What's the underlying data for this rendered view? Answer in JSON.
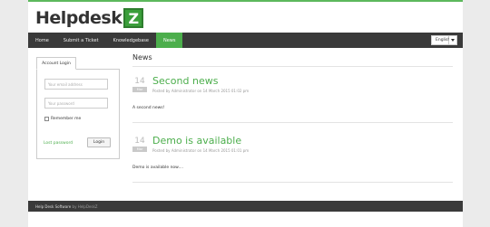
{
  "logo": {
    "text": "Helpdesk",
    "badge": "Z"
  },
  "nav": {
    "items": [
      "Home",
      "Submit a Ticket",
      "Knowledgebase",
      "News"
    ],
    "active": "News"
  },
  "language": {
    "selected": "English"
  },
  "login": {
    "tab_label": "Account Login",
    "email_placeholder": "Your email address",
    "password_placeholder": "Your password",
    "remember_label": "Remember me",
    "lost_password": "Lost password",
    "login_button": "Login"
  },
  "main": {
    "heading": "News",
    "articles": [
      {
        "day": "14",
        "month": "Mar",
        "title": "Second news",
        "meta": "Posted by Administrator on 14 March 2015 01:02 pm",
        "body": "A second news!"
      },
      {
        "day": "14",
        "month": "Mar",
        "title": "Demo is available",
        "meta": "Posted by Administrator on 14 March 2015 01:01 pm",
        "body": "Demo is available now...."
      }
    ]
  },
  "footer": {
    "text": "Help Desk Software",
    "by": "by HelpDeskZ"
  },
  "colors": {
    "accent": "#4cae4c",
    "nav_bg": "#3a3a3a",
    "page_bg": "#ebebeb"
  }
}
